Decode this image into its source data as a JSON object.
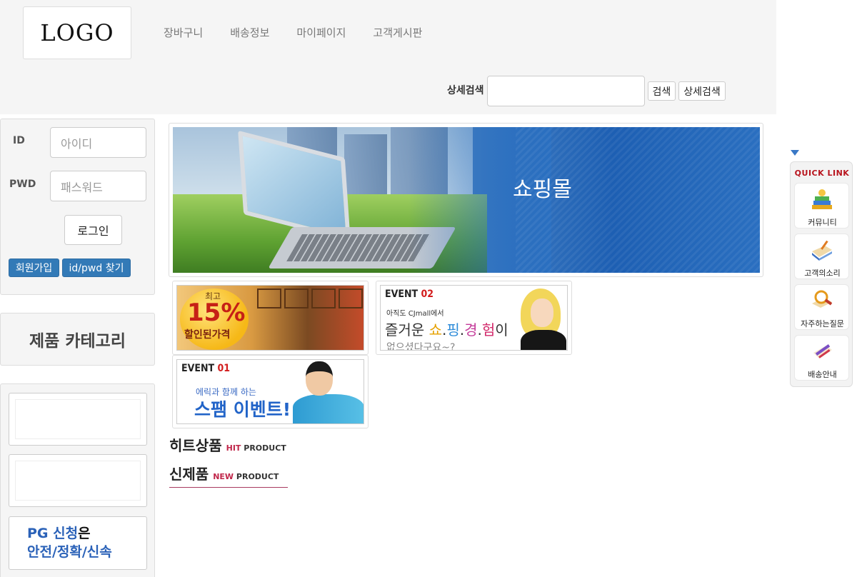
{
  "header": {
    "logo": "LOGO",
    "nav": [
      "장바구니",
      "배송정보",
      "마이페이지",
      "고객게시판"
    ],
    "search_label": "상세검색",
    "search_value": "",
    "search_button": "검색",
    "detail_search_button": "상세검색"
  },
  "login": {
    "id_label": "ID",
    "id_placeholder": "아이디",
    "pwd_label": "PWD",
    "pwd_placeholder": "패스워드",
    "login_button": "로그인",
    "signup_button": "회원가입",
    "find_button": "id/pwd 찾기"
  },
  "category": {
    "title": "제품 카테고리"
  },
  "side_banner": {
    "pg_line1_blue": "PG 신청",
    "pg_line1_black": "은",
    "pg_line2": "안전/정확/신속"
  },
  "main_banner": {
    "title": "쇼핑몰"
  },
  "events": {
    "discount_small": "최고",
    "discount_pct": "15%",
    "discount_label": "할인된가격",
    "event2_title": "EVENT",
    "event2_num": "02",
    "event2_sub": "아직도 CJmall에서",
    "event2_main_pre": "즐거운 ",
    "event2_c1": "쇼",
    "event2_c2": "핑",
    "event2_c3": "경",
    "event2_c4": "험",
    "event2_main_post": "이",
    "event2_bottom": "없으셨다구요~?",
    "event1_title": "EVENT",
    "event1_num": "01",
    "event1_sub": "에릭과 함께 하는",
    "event1_main": "스팸 이벤트!"
  },
  "products": {
    "hit_title": "히트상품",
    "hit_sub_red": "HIT",
    "hit_sub": "PRODUCT",
    "new_title": "신제품",
    "new_sub_red": "NEW",
    "new_sub": "PRODUCT"
  },
  "quick_link": {
    "header": "QUICK LINK",
    "items": [
      "커뮤니티",
      "고객의소리",
      "자주하는질문",
      "배송안내"
    ]
  },
  "colors": {
    "accent_blue": "#337ab7",
    "quick_link_red": "#b8141d"
  }
}
